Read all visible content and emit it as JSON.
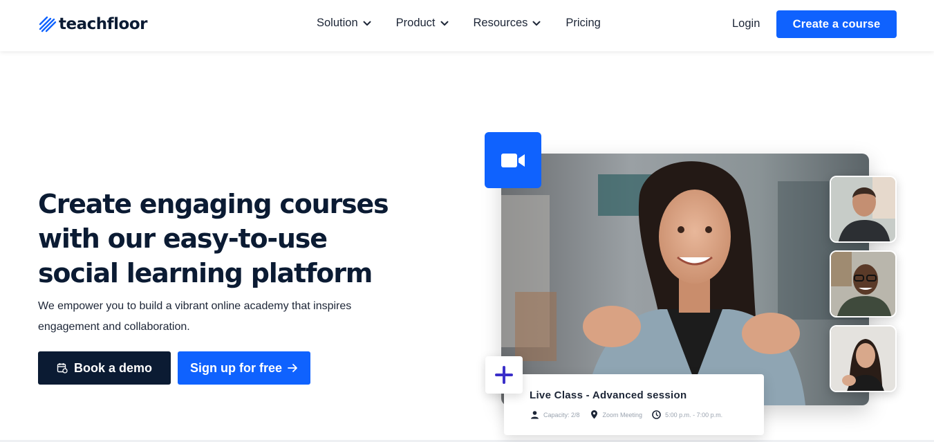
{
  "brand": {
    "name": "teachfloor",
    "color": "#0f62fe",
    "dark": "#0b1b33"
  },
  "nav": {
    "items": [
      {
        "label": "Solution",
        "icon": "chevron-down-icon"
      },
      {
        "label": "Product",
        "icon": "chevron-down-icon"
      },
      {
        "label": "Resources",
        "icon": "chevron-down-icon"
      },
      {
        "label": "Pricing"
      }
    ],
    "login": "Login",
    "cta": "Create a course"
  },
  "hero": {
    "title_lines": [
      "Create engaging courses",
      "with our easy-to-use",
      "social learning platform"
    ],
    "subtitle_lines": [
      "We empower you to build a vibrant online academy that inspires",
      "engagement and collaboration."
    ],
    "demo_button": "Book a demo",
    "signup_button": "Sign up for free"
  },
  "live_class": {
    "title": "Live Class - Advanced session",
    "capacity": "Capacity: 2/8",
    "location": "Zoom Meeting",
    "time": "5:00 p.m. - 7:00 p.m."
  }
}
